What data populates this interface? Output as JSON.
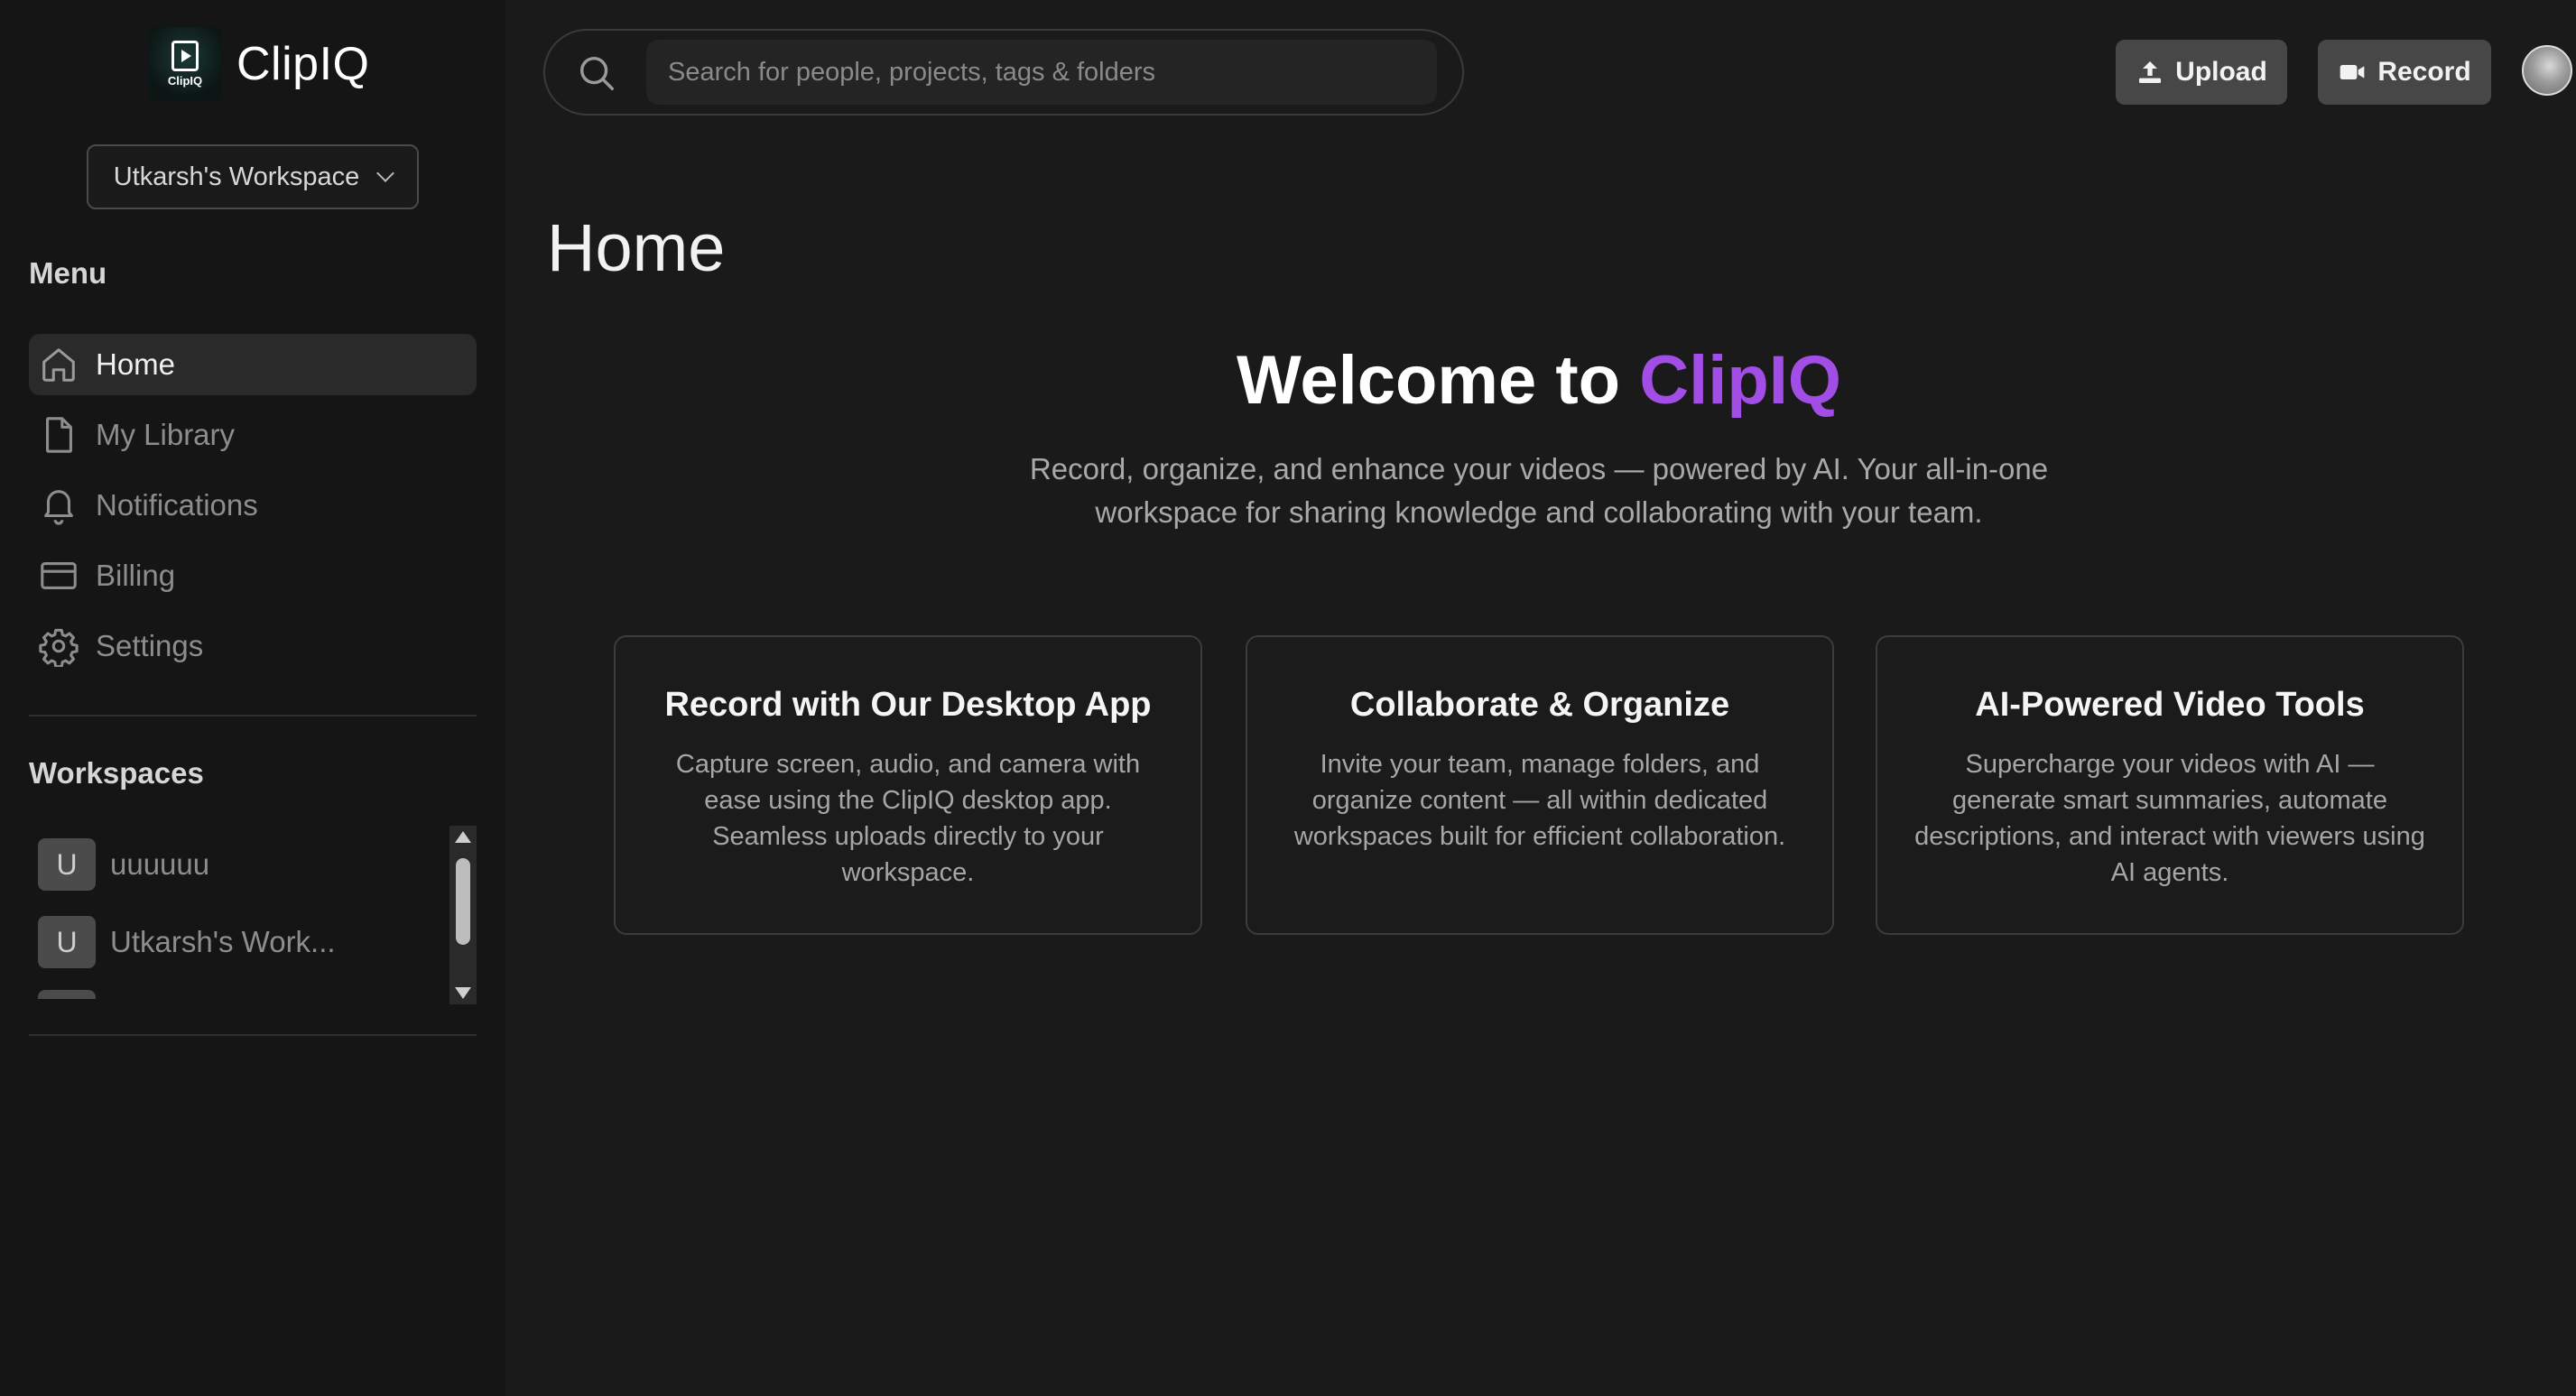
{
  "app": {
    "name": "ClipIQ",
    "logo_mini": "ClipIQ"
  },
  "workspace_switcher": {
    "label": "Utkarsh's Workspace"
  },
  "sidebar": {
    "menu_label": "Menu",
    "items": [
      {
        "label": "Home",
        "icon": "home-icon",
        "active": true
      },
      {
        "label": "My Library",
        "icon": "file-icon",
        "active": false
      },
      {
        "label": "Notifications",
        "icon": "bell-icon",
        "active": false
      },
      {
        "label": "Billing",
        "icon": "credit-card-icon",
        "active": false
      },
      {
        "label": "Settings",
        "icon": "gear-icon",
        "active": false
      }
    ],
    "workspaces_label": "Workspaces",
    "workspaces": [
      {
        "initial": "U",
        "name": "uuuuuu"
      },
      {
        "initial": "U",
        "name": "Utkarsh's Work..."
      }
    ]
  },
  "search": {
    "placeholder": "Search for people, projects, tags & folders"
  },
  "toolbar": {
    "upload_label": "Upload",
    "record_label": "Record"
  },
  "main": {
    "title": "Home",
    "welcome_prefix": "Welcome to ",
    "welcome_brand": "ClipIQ",
    "tagline_line1": "Record, organize, and enhance your videos — powered by AI. Your all-in-one",
    "tagline_line2": "workspace for sharing knowledge and collaborating with your team.",
    "cards": [
      {
        "title": "Record with Our Desktop App",
        "body": "Capture screen, audio, and camera with ease using the ClipIQ desktop app. Seamless uploads directly to your workspace."
      },
      {
        "title": "Collaborate & Organize",
        "body": "Invite your team, manage folders, and organize content — all within dedicated workspaces built for efficient collaboration."
      },
      {
        "title": "AI-Powered Video Tools",
        "body": "Supercharge your videos with AI — generate smart summaries, automate descriptions, and interact with viewers using AI agents."
      }
    ]
  },
  "colors": {
    "brand": "#a24ee6",
    "background": "#1a1a1a",
    "sidebar": "#151515"
  }
}
